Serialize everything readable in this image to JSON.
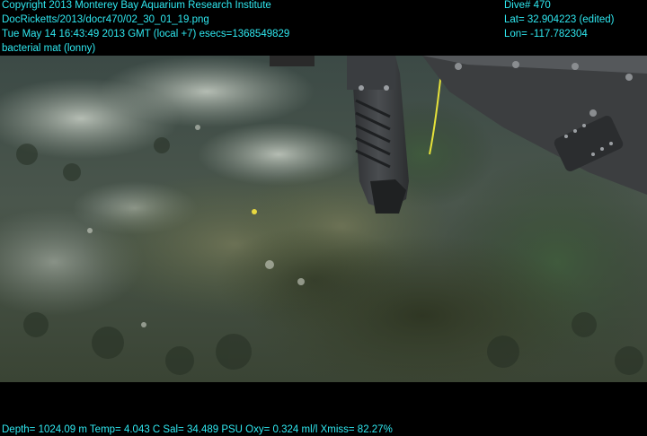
{
  "header": {
    "copyright": "Copyright 2013 Monterey Bay Aquarium Research Institute",
    "filename": "DocRicketts/2013/docr470/02_30_01_19.png",
    "timestamp": "Tue May 14 16:43:49 2013 GMT (local +7)  esecs=1368549829",
    "annotation": "bacterial mat (lonny)",
    "dive": "Dive# 470",
    "lat": "Lat= 32.904223 (edited)",
    "lon": "Lon= -117.782304"
  },
  "footer": {
    "telemetry": "Depth= 1024.09 m  Temp= 4.043 C  Sal= 34.489 PSU  Oxy= 0.324 ml/l  Xmiss= 82.27%"
  },
  "colors": {
    "overlay_text": "#2fe8f0",
    "background": "#000000"
  }
}
